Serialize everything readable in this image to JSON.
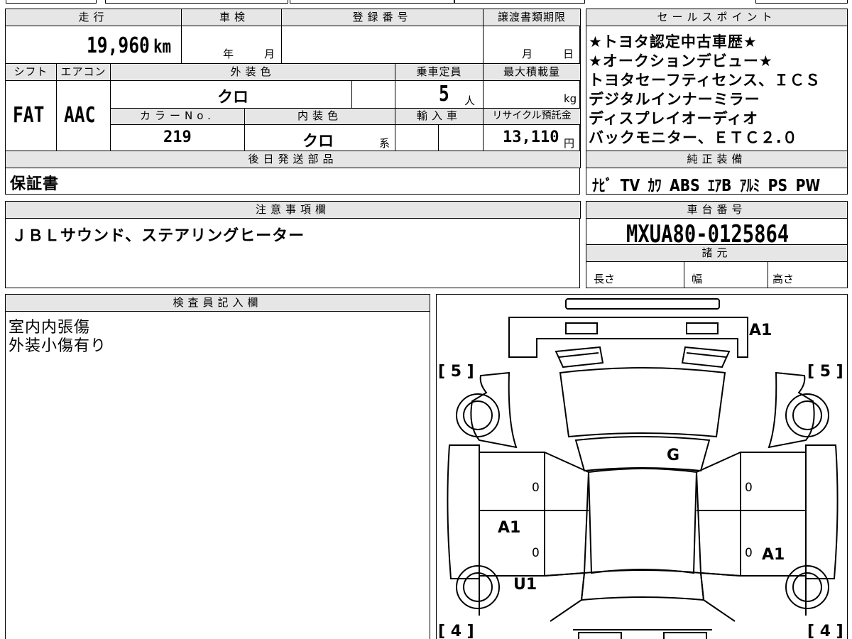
{
  "top_left": {
    "mileage_label": "走行",
    "mileage_value": "19,960",
    "mileage_unit": "km",
    "shaken_label": "車検",
    "shaken_year": "年",
    "shaken_month": "月",
    "reg_label": "登録番号",
    "transfer_label": "譲渡書類期限",
    "transfer_month": "月",
    "transfer_day": "日",
    "shift_label": "シフト",
    "aircon_label": "エアコン",
    "ext_color_label": "外装色",
    "capacity_label": "乗車定員",
    "max_load_label": "最大積載量",
    "shift_value": "FAT",
    "aircon_value": "AAC",
    "ext_color_value": "クロ",
    "capacity_value": "5",
    "capacity_unit": "人",
    "max_load_unit": "kg",
    "color_no_label": "カラーNo.",
    "int_color_label": "内装色",
    "import_label": "輸入車",
    "recycle_label": "リサイクル預託金",
    "color_no_value": "219",
    "int_color_value": "クロ",
    "int_color_unit": "系",
    "recycle_value": "13,110",
    "recycle_unit": "円",
    "later_parts_label": "後日発送部品",
    "later_parts_value": "保証書"
  },
  "sales": {
    "label": "セールスポイント",
    "lines": [
      "★トヨタ認定中古車歴★",
      "★オークションデビュー★",
      "トヨタセーフティセンス、ＩＣＳ",
      "デジタルインナーミラー",
      "ディスプレイオーディオ",
      "バックモニター、ＥＴＣ２.０"
    ]
  },
  "equipment": {
    "label": "純正装備",
    "items": [
      "ﾅﾋﾞ",
      "TV",
      "ｶﾜ",
      "ABS",
      "ｴｱB",
      "ｱﾙﾐ",
      "PS",
      "PW"
    ]
  },
  "notes": {
    "label": "注意事項欄",
    "value": "ＪＢＬサウンド、ステアリングヒーター"
  },
  "chassis": {
    "label": "車台番号",
    "value": "MXUA80-0125864",
    "spec_label": "諸元",
    "length_label": "長さ",
    "width_label": "幅",
    "height_label": "高さ"
  },
  "inspector": {
    "label": "検査員記入欄",
    "lines": [
      "室内内張傷",
      "外装小傷有り"
    ]
  },
  "diagram": {
    "tire_fl": "[ 5 ]",
    "tire_fr": "[ 5 ]",
    "tire_rl": "[ 4 ]",
    "tire_rr": "[ 4 ]",
    "mark_front": "A1",
    "mark_windshield": "G",
    "mark_left_rear_door": "A1",
    "mark_right_rear_door": "A1",
    "mark_left_rear": "U1",
    "zero_left_front": "0",
    "zero_right_front": "0",
    "zero_left_rear": "0",
    "zero_right_rear": "0"
  }
}
